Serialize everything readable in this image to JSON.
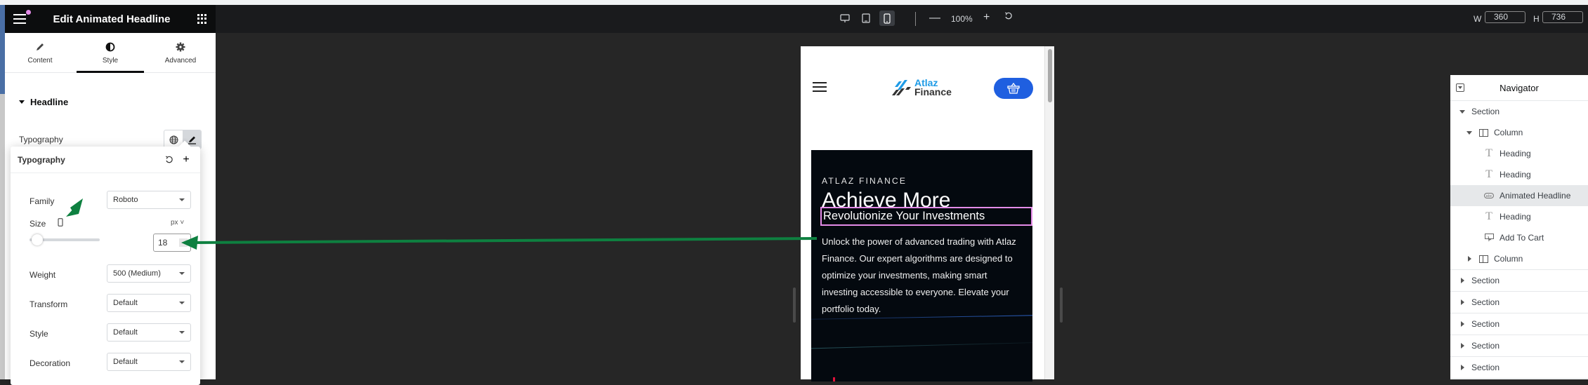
{
  "panel": {
    "title": "Edit Animated Headline",
    "tabs": [
      {
        "label": "Content",
        "icon": "pencil-icon",
        "active": false
      },
      {
        "label": "Style",
        "icon": "contrast-icon",
        "active": true
      },
      {
        "label": "Advanced",
        "icon": "gear-icon",
        "active": false
      }
    ],
    "section": "Headline",
    "typography_label": "Typography",
    "popover": {
      "title": "Typography",
      "family_label": "Family",
      "family_value": "Roboto",
      "size_label": "Size",
      "size_unit": "px",
      "size_value": "18",
      "weight_label": "Weight",
      "weight_value": "500 (Medium)",
      "transform_label": "Transform",
      "transform_value": "Default",
      "style_label": "Style",
      "style_value": "Default",
      "decoration_label": "Decoration",
      "decoration_value": "Default"
    }
  },
  "toolbar": {
    "zoom": "100%",
    "width_label": "W",
    "width_value": "360",
    "height_label": "H",
    "height_value": "736",
    "active_device": "mobile"
  },
  "preview": {
    "logo_top": "Atlaz",
    "logo_bottom": "Finance",
    "kicker": "ATLAZ FINANCE",
    "heading": "Achieve More",
    "animated_headline": "Revolutionize Your Investments",
    "paragraph": "Unlock the power of advanced trading with Atlaz Finance. Our expert algorithms are designed to optimize your investments, making smart investing accessible to everyone. Elevate your portfolio today."
  },
  "navigator": {
    "title": "Navigator",
    "items": [
      {
        "label": "Section",
        "level": 0,
        "expanded": true,
        "icon": "none"
      },
      {
        "label": "Column",
        "level": 1,
        "expanded": true,
        "icon": "column-icon"
      },
      {
        "label": "Heading",
        "level": 2,
        "icon": "heading-icon"
      },
      {
        "label": "Heading",
        "level": 2,
        "icon": "heading-icon"
      },
      {
        "label": "Animated Headline",
        "level": 2,
        "icon": "animated-headline-icon",
        "selected": true
      },
      {
        "label": "Heading",
        "level": 2,
        "icon": "heading-icon"
      },
      {
        "label": "Add To Cart",
        "level": 2,
        "icon": "add-to-cart-icon"
      },
      {
        "label": "Column",
        "level": 1,
        "expanded": false,
        "icon": "column-icon"
      },
      {
        "label": "Section",
        "level": 0,
        "expanded": false
      },
      {
        "label": "Section",
        "level": 0,
        "expanded": false
      },
      {
        "label": "Section",
        "level": 0,
        "expanded": false
      },
      {
        "label": "Section",
        "level": 0,
        "expanded": false
      },
      {
        "label": "Section",
        "level": 0,
        "expanded": false
      }
    ]
  },
  "colors": {
    "annotation_arrow": "#0e8040",
    "selection_outline": "#e48be8",
    "cart_button": "#1f5fe0"
  }
}
